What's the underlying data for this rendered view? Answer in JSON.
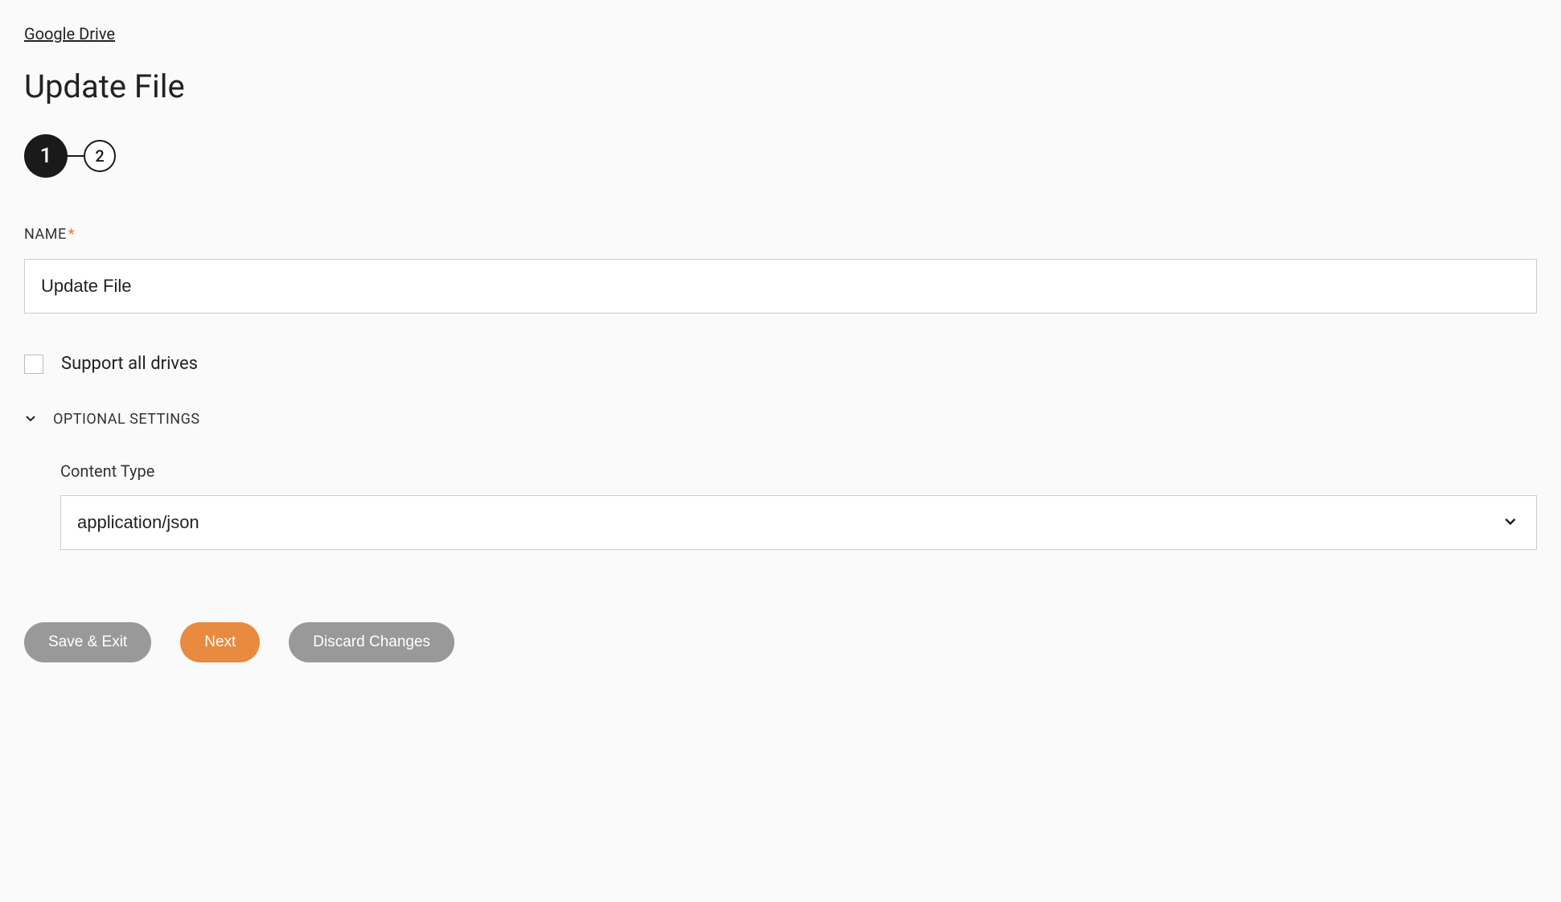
{
  "breadcrumb": "Google Drive",
  "page_title": "Update File",
  "stepper": {
    "steps": [
      "1",
      "2"
    ],
    "active_index": 0
  },
  "fields": {
    "name": {
      "label": "NAME",
      "required": true,
      "value": "Update File"
    },
    "support_all_drives": {
      "label": "Support all drives",
      "checked": false
    },
    "optional_settings": {
      "label": "OPTIONAL SETTINGS",
      "expanded": true,
      "content_type": {
        "label": "Content Type",
        "value": "application/json"
      }
    }
  },
  "buttons": {
    "save_exit": "Save & Exit",
    "next": "Next",
    "discard": "Discard Changes"
  }
}
